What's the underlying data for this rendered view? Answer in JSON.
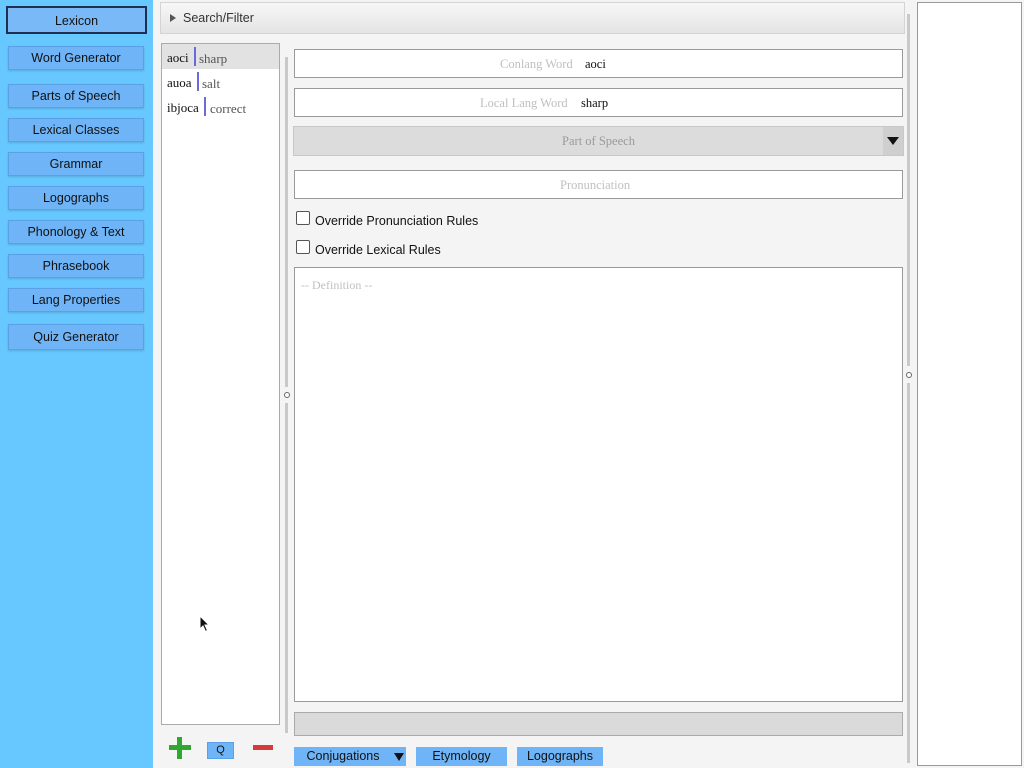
{
  "nav": {
    "items": [
      {
        "label": "Lexicon",
        "active": true
      },
      {
        "label": "Word Generator"
      },
      {
        "label": "Parts of Speech"
      },
      {
        "label": "Lexical Classes"
      },
      {
        "label": "Grammar"
      },
      {
        "label": "Logographs"
      },
      {
        "label": "Phonology & Text"
      },
      {
        "label": "Phrasebook"
      },
      {
        "label": "Lang Properties"
      },
      {
        "label": "Quiz Generator"
      }
    ]
  },
  "search": {
    "label": "Search/Filter"
  },
  "wordlist": {
    "rows": [
      {
        "conlang": "aoci",
        "local": "sharp",
        "selected": true
      },
      {
        "conlang": "auoa",
        "local": "salt"
      },
      {
        "conlang": "ibjoca",
        "local": "correct"
      }
    ]
  },
  "form": {
    "conlang_placeholder": "Conlang Word",
    "conlang_value": "aoci",
    "local_placeholder": "Local Lang Word",
    "local_value": "sharp",
    "pos_placeholder": "Part of Speech",
    "pronunciation_placeholder": "Pronunciation",
    "override_pronunciation": "Override Pronunciation Rules",
    "override_lexical": "Override Lexical Rules",
    "definition_placeholder": "-- Definition --"
  },
  "tabs": {
    "conjugations": "Conjugations",
    "etymology": "Etymology",
    "logographs": "Logographs"
  },
  "actions": {
    "query_label": "Q"
  },
  "colors": {
    "nav_bg": "#66c8ff",
    "button": "#6fb4f6",
    "add": "#2fa82f",
    "remove": "#d53b3b"
  }
}
